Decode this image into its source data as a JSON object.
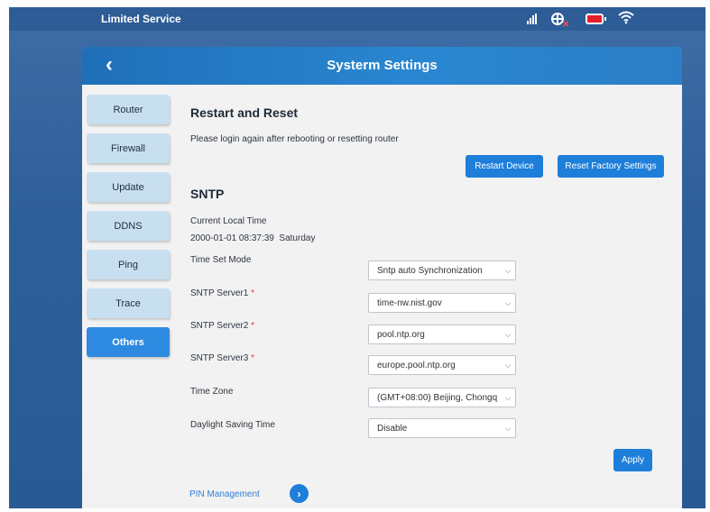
{
  "statusbar": {
    "service_text": "Limited Service",
    "icons": [
      "signal-icon",
      "globe-icon",
      "battery-icon",
      "wifi-icon"
    ],
    "battery_color": "#e41e2b"
  },
  "header": {
    "back_icon": "‹",
    "title": "Systerm Settings"
  },
  "sidebar": {
    "items": [
      {
        "label": "Router"
      },
      {
        "label": "Firewall"
      },
      {
        "label": "Update"
      },
      {
        "label": "DDNS"
      },
      {
        "label": "Ping"
      },
      {
        "label": "Trace"
      },
      {
        "label": "Others",
        "active": true
      }
    ]
  },
  "restart": {
    "title": "Restart and Reset",
    "description": "Please login again after rebooting or resetting router",
    "restart_button": "Restart Device",
    "reset_button": "Reset Factory Settings"
  },
  "sntp": {
    "title": "SNTP",
    "current_time_label": "Current Local Time",
    "current_time_value": "2000-01-01 08:37:39  Saturday",
    "fields": [
      {
        "label": "Time Set Mode",
        "required": "",
        "value": "Sntp auto Synchronization"
      },
      {
        "label": "SNTP Server1",
        "required": "*",
        "value": "time-nw.nist.gov"
      },
      {
        "label": "SNTP Server2",
        "required": "*",
        "value": "pool.ntp.org"
      },
      {
        "label": "SNTP Server3",
        "required": "*",
        "value": "europe.pool.ntp.org"
      },
      {
        "label": "Time Zone",
        "required": "",
        "value": "(GMT+08:00) Beijing, Chongq"
      },
      {
        "label": "Daylight Saving Time",
        "required": "",
        "value": "Disable"
      }
    ],
    "apply_button": "Apply"
  },
  "pin": {
    "label": "PIN Management",
    "arrow": "›"
  },
  "colors": {
    "header_blue": "#2a86d1",
    "button_blue": "#1e7fda",
    "active_tab": "#2e8ae0",
    "tab": "#c8dff0",
    "required": "#e23b3b"
  }
}
